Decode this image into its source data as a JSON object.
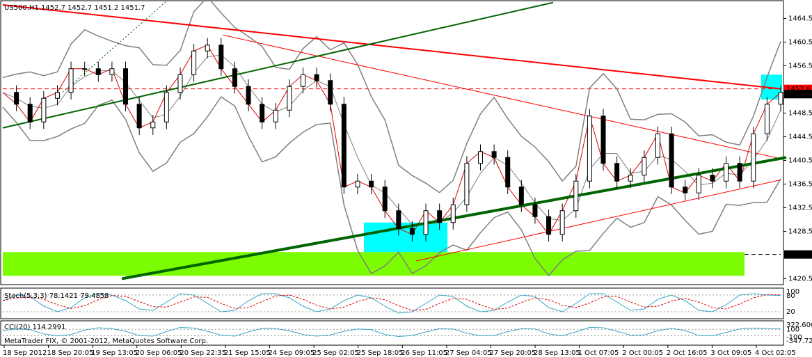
{
  "header": {
    "symbol_line": "US500,H1  1452.7  1452.7  1451.2  1451.7"
  },
  "footer": {
    "copyright": "MetaTrader FIX, © 2001-2012, MetaQuotes Software Corp."
  },
  "colors": {
    "candle": "#000000",
    "bollinger": "#7f7f7f",
    "ma": "#dd0000",
    "trend_red": "#ff0000",
    "trend_green": "#006400",
    "support_zone": "#7cfc00",
    "highlight_zone": "#00ffff",
    "stoch_main": "#3aa6c8",
    "stoch_signal": "#dd0000",
    "cci": "#3aa6c8"
  },
  "chart_data": [
    {
      "type": "candlestick",
      "title": "US500,H1",
      "ohlc_last": {
        "open": 1452.7,
        "high": 1452.7,
        "low": 1451.2,
        "close": 1451.7
      },
      "ylim": [
        1419.5,
        1467.5
      ],
      "y_ticks": [
        1420.5,
        1424.6,
        1428.5,
        1432.5,
        1436.5,
        1440.5,
        1444.5,
        1448.5,
        1452.6,
        1456.5,
        1460.5,
        1464.5
      ],
      "price_labels": [
        {
          "text": "1452.6",
          "value": 1452.6,
          "color": "#ff0000"
        },
        {
          "text": "1451.7",
          "value": 1451.7,
          "color": "#ffffff"
        },
        {
          "text": "1424.6",
          "value": 1424.6,
          "color": "#ffffff"
        }
      ],
      "x_labels": [
        "18 Sep 2012",
        "18 Sep 20:05",
        "19 Sep 13:05",
        "20 Sep 06:05",
        "20 Sep 22:35",
        "21 Sep 15:05",
        "24 Sep 09:05",
        "25 Sep 02:05",
        "25 Sep 18:05",
        "26 Sep 11:05",
        "27 Sep 04:05",
        "27 Sep 20:05",
        "28 Sep 13:05",
        "1 Oct 07:05",
        "2 Oct 00:05",
        "2 Oct 16:05",
        "3 Oct 09:05",
        "4 Oct 02:05"
      ],
      "close_path": [
        1452,
        1450,
        1447,
        1451,
        1452,
        1456,
        1456,
        1455,
        1456,
        1450,
        1446,
        1447,
        1452,
        1455,
        1459,
        1460,
        1456,
        1453,
        1450,
        1447,
        1449,
        1453,
        1455,
        1454,
        1450,
        1436,
        1437,
        1436,
        1432,
        1429,
        1428,
        1432,
        1430,
        1433,
        1440,
        1442,
        1441,
        1436,
        1433,
        1431,
        1428,
        1432,
        1437,
        1448,
        1440,
        1437,
        1438,
        1441,
        1445,
        1436,
        1435,
        1438,
        1437,
        1440,
        1437,
        1445,
        1450,
        1452
      ],
      "indicators": [
        "Bollinger Bands (20)",
        "Moving Average",
        "Trend lines"
      ],
      "zones": [
        {
          "name": "support zone",
          "from": 1421.0,
          "to": 1425.0
        },
        {
          "name": "highlight zone 1",
          "from": 1425.0,
          "to": 1430.0
        },
        {
          "name": "highlight zone 2",
          "from": 1450.8,
          "to": 1455.0
        }
      ]
    },
    {
      "type": "line",
      "title": "Stoch(5,3,3) 78.1421 79.4858",
      "ylim": [
        0,
        100
      ],
      "y_ticks": [
        "100",
        "80",
        "20"
      ],
      "series": [
        {
          "name": "main",
          "values": [
            60,
            80,
            75,
            40,
            20,
            35,
            70,
            85,
            80,
            60,
            30,
            25,
            55,
            85,
            80,
            50,
            20,
            25,
            60,
            85,
            85,
            70,
            40,
            20,
            30,
            60,
            80,
            70,
            40,
            15,
            20,
            50,
            80,
            75,
            40,
            20,
            25,
            55,
            80,
            75,
            35,
            20,
            50,
            85,
            85,
            55,
            25,
            30,
            65,
            80,
            60,
            25,
            20,
            45,
            80,
            85,
            80,
            78
          ]
        }
      ]
    },
    {
      "type": "line",
      "title": "CCI(20) 114.2991",
      "y_ticks": [
        "322.600",
        "100",
        "-100",
        "-347.720"
      ],
      "series": [
        {
          "name": "CCI",
          "values": [
            60,
            110,
            90,
            -40,
            -100,
            -60,
            80,
            150,
            120,
            40,
            -90,
            -110,
            30,
            160,
            140,
            40,
            -80,
            -110,
            20,
            130,
            120,
            60,
            -60,
            -110,
            -70,
            40,
            110,
            90,
            -60,
            -120,
            -90,
            20,
            120,
            110,
            -20,
            -100,
            -90,
            30,
            120,
            110,
            -40,
            -100,
            20,
            160,
            150,
            40,
            -80,
            -70,
            60,
            130,
            60,
            -90,
            -100,
            0,
            110,
            140,
            120,
            114
          ]
        }
      ]
    }
  ]
}
